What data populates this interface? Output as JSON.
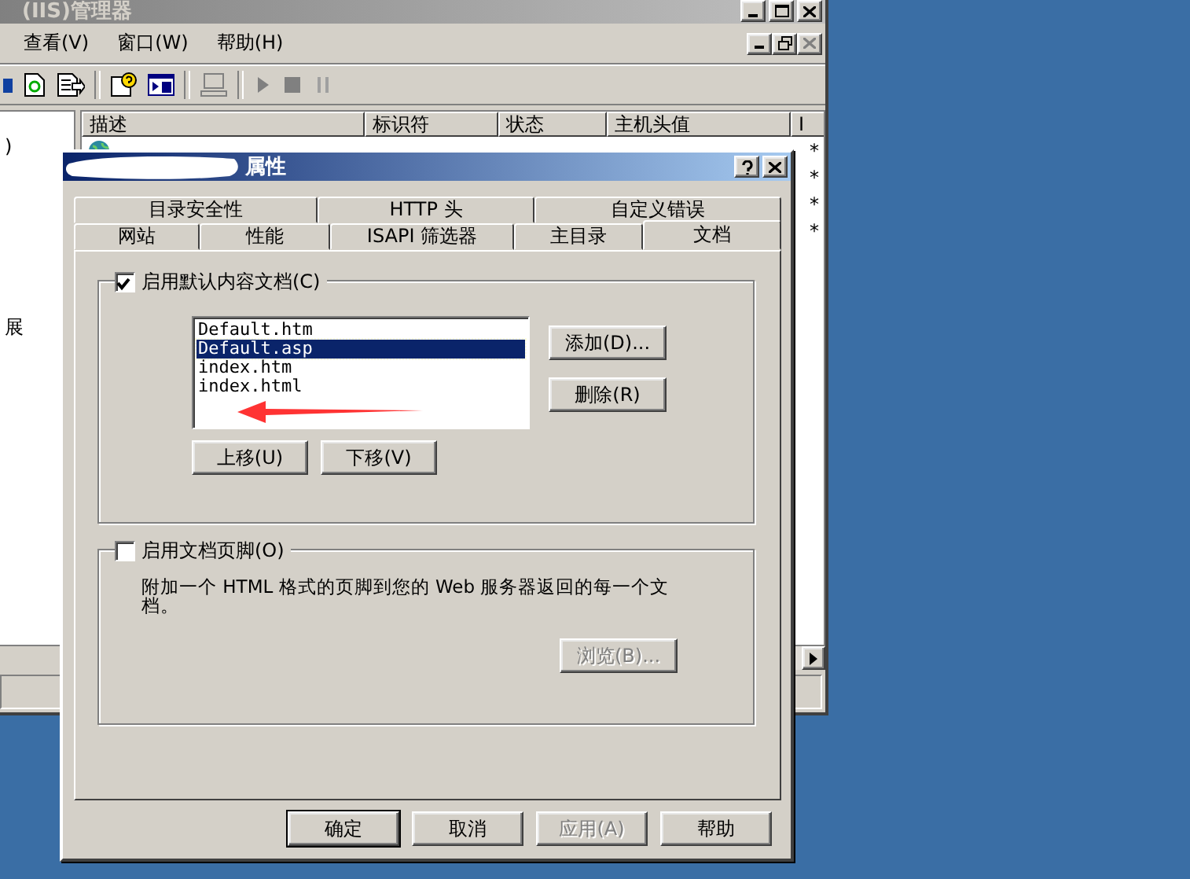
{
  "main_window": {
    "title": "(IIS)管理器",
    "menu": [
      "查看(V)",
      "窗口(W)",
      "帮助(H)"
    ],
    "tree_items": [
      ")",
      "展"
    ],
    "list": {
      "columns": [
        "描述",
        "标识符",
        "状态",
        "主机头值",
        "I"
      ],
      "rows": [
        {
          "kind": "site",
          "column_5": "*"
        },
        {
          "column_5": "*"
        },
        {
          "column_5": "*"
        },
        {
          "column_5": "*"
        }
      ]
    }
  },
  "dialog": {
    "title": "属性",
    "tabs_back": [
      {
        "label": "目录安全性",
        "selected": false
      },
      {
        "label": "HTTP 头",
        "selected": false
      },
      {
        "label": "自定义错误",
        "selected": false
      }
    ],
    "tabs_front": [
      {
        "label": "网站",
        "selected": false
      },
      {
        "label": "性能",
        "selected": false
      },
      {
        "label": "ISAPI 筛选器",
        "selected": false
      },
      {
        "label": "主目录",
        "selected": false
      },
      {
        "label": "文档",
        "selected": true
      }
    ],
    "default_docs": {
      "label": "启用默认内容文档(C)",
      "checked": true,
      "items": [
        {
          "label": "Default.htm",
          "selected": false
        },
        {
          "label": "Default.asp",
          "selected": true
        },
        {
          "label": "index.htm",
          "selected": false
        },
        {
          "label": "index.html",
          "selected": false
        }
      ],
      "side_buttons": [
        {
          "label": "添加(D)...",
          "disabled": false
        },
        {
          "label": "删除(R)",
          "disabled": false
        }
      ],
      "move_buttons": [
        {
          "label": "上移(U)",
          "disabled": false
        },
        {
          "label": "下移(V)",
          "disabled": false
        }
      ]
    },
    "footer": {
      "label": "启用文档页脚(O)",
      "checked": false,
      "description": "附加一个 HTML 格式的页脚到您的 Web 服务器返回的每一个文档。",
      "browse": {
        "label": "浏览(B)...",
        "disabled": true
      }
    },
    "buttons": [
      {
        "label": "确定",
        "disabled": false,
        "default": true
      },
      {
        "label": "取消",
        "disabled": false,
        "default": false
      },
      {
        "label": "应用(A)",
        "disabled": true,
        "default": false
      },
      {
        "label": "帮助",
        "disabled": false,
        "default": false
      }
    ]
  }
}
